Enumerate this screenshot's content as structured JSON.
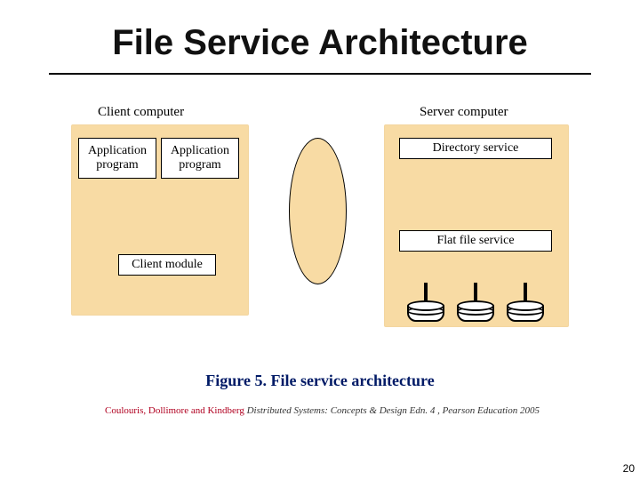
{
  "title": "File Service Architecture",
  "diagram": {
    "client_label": "Client computer",
    "server_label": "Server computer",
    "app_program": "Application\nprogram",
    "client_module": "Client module",
    "directory_service": "Directory service",
    "flat_file_service": "Flat file service"
  },
  "caption": {
    "prefix": "Figure 5. ",
    "text": "File service architecture"
  },
  "attribution": {
    "authors": "Coulouris, Dollimore and Kindberg",
    "rest": " Distributed Systems: Concepts & Design  Edn. 4 ,  Pearson Education 2005"
  },
  "page_number": "20",
  "chart_data": {
    "type": "diagram",
    "nodes": [
      {
        "id": "client",
        "label": "Client computer",
        "children": [
          "app1",
          "app2",
          "client_module"
        ]
      },
      {
        "id": "app1",
        "label": "Application program"
      },
      {
        "id": "app2",
        "label": "Application program"
      },
      {
        "id": "client_module",
        "label": "Client module"
      },
      {
        "id": "network",
        "label": "(network ellipse)"
      },
      {
        "id": "server",
        "label": "Server computer",
        "children": [
          "directory_service",
          "flat_file_service",
          "disks"
        ]
      },
      {
        "id": "directory_service",
        "label": "Directory service"
      },
      {
        "id": "flat_file_service",
        "label": "Flat file service"
      },
      {
        "id": "disks",
        "label": "Storage disks (3)"
      }
    ],
    "edges": [
      {
        "from": "client",
        "to": "network"
      },
      {
        "from": "network",
        "to": "server"
      },
      {
        "from": "flat_file_service",
        "to": "disks"
      }
    ]
  }
}
